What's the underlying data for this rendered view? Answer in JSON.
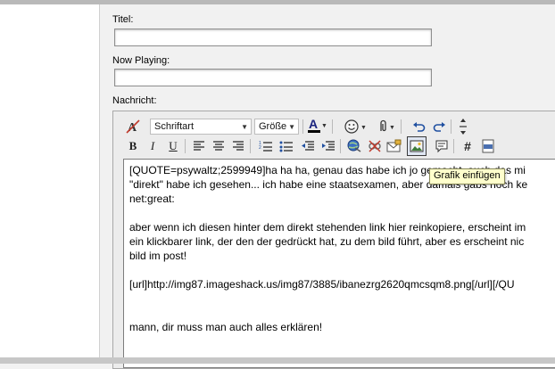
{
  "form": {
    "title_label": "Titel:",
    "title_value": "",
    "nowplaying_label": "Now Playing:",
    "nowplaying_value": "",
    "message_label": "Nachricht:"
  },
  "toolbar": {
    "font_select": "Schriftart",
    "size_select": "Größe",
    "bold": "B",
    "italic": "I",
    "underline": "U",
    "hash": "#",
    "text_color_letter": "A"
  },
  "icons": {
    "remove_format": "remove-format-icon",
    "font_color": "font-color-icon",
    "smilies": "smiley-icon",
    "attachment": "paperclip-icon",
    "undo": "undo-icon",
    "redo": "redo-icon",
    "resize": "resize-toggle-icon",
    "align_left": "align-left-icon",
    "align_center": "align-center-icon",
    "align_right": "align-right-icon",
    "ordered_list": "ordered-list-icon",
    "unordered_list": "unordered-list-icon",
    "outdent": "outdent-icon",
    "indent": "indent-icon",
    "insert_link": "insert-link-icon",
    "remove_link": "remove-link-icon",
    "insert_email": "insert-email-icon",
    "insert_image": "insert-image-icon",
    "quote": "quote-icon",
    "php": "php-icon"
  },
  "tooltip": "Grafik einfügen",
  "message": {
    "lines": [
      "[QUOTE=psywaltz;2599949]ha ha ha, genau das habe ich jo gemacht. auch das mi",
      "\"direkt\" habe ich gesehen... ich habe eine staatsexamen, aber damals gabs noch ke",
      "net:great:",
      "",
      "aber wenn ich diesen hinter dem direkt stehenden link hier reinkopiere, erscheint im",
      "ein klickbarer link, der den der gedrückt hat, zu dem bild führt, aber es erscheint nic",
      "bild im post!",
      "",
      "[url]http://img87.imageshack.us/img87/3885/ibanezrg2620qmcsqm8.png[/url][/QU",
      "",
      "",
      "mann, dir muss man auch alles erklären!"
    ]
  },
  "colors": {
    "page_bg": "#f2f2f2",
    "tooltip_bg": "#ffffcc",
    "text_color_bar": "#000000"
  }
}
